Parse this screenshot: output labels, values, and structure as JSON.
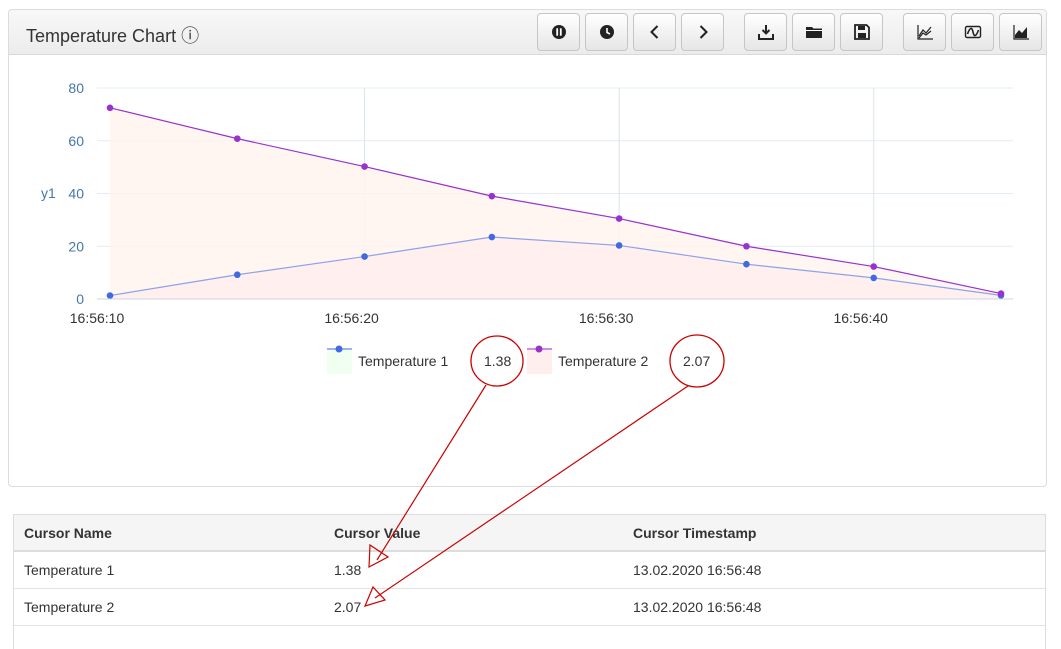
{
  "panel": {
    "title": "Temperature Chart ⓘ"
  },
  "toolbar": {
    "buttons": [
      {
        "name": "pause-button",
        "icon": "pause-icon"
      },
      {
        "name": "history-button",
        "icon": "clock-icon"
      },
      {
        "name": "previous-button",
        "icon": "chevron-left-icon"
      },
      {
        "name": "next-button",
        "icon": "chevron-right-icon"
      },
      {
        "name": "download-button",
        "icon": "download-icon"
      },
      {
        "name": "open-folder-button",
        "icon": "folder-icon"
      },
      {
        "name": "save-button",
        "icon": "floppy-disk-icon"
      },
      {
        "name": "line-chart-button",
        "icon": "line-chart-icon"
      },
      {
        "name": "wave-button",
        "icon": "sine-wave-icon"
      },
      {
        "name": "area-chart-button",
        "icon": "area-chart-icon"
      }
    ]
  },
  "chart_data": {
    "type": "line",
    "ylabel": "y1",
    "ylim": [
      0,
      80
    ],
    "yticks": [
      "0",
      "20",
      "40",
      "60",
      "80"
    ],
    "xticks": [
      "16:56:10",
      "16:56:20",
      "16:56:30",
      "16:56:40"
    ],
    "x": [
      "16:56:10",
      "16:56:15",
      "16:56:20",
      "16:56:25",
      "16:56:30",
      "16:56:35",
      "16:56:40",
      "16:56:45"
    ],
    "grid": true,
    "legend": "bottom",
    "series": [
      {
        "name": "Temperature 1",
        "color": "#4169e1",
        "values": [
          1.3,
          9.2,
          16.1,
          23.5,
          20.3,
          13.2,
          8.0,
          1.38
        ],
        "cursor_value": "1.38"
      },
      {
        "name": "Temperature 2",
        "color": "#9932cc",
        "values": [
          72.5,
          60.8,
          50.2,
          39.0,
          30.5,
          20.0,
          12.3,
          2.07
        ],
        "cursor_value": "2.07"
      }
    ]
  },
  "table": {
    "headers": [
      "Cursor Name",
      "Cursor Value",
      "Cursor Timestamp"
    ],
    "rows": [
      [
        "Temperature 1",
        "1.38",
        "13.02.2020 16:56:48"
      ],
      [
        "Temperature 2",
        "2.07",
        "13.02.2020 16:56:48"
      ]
    ]
  },
  "colors": {
    "annotation": "#cc0000",
    "axis_text": "#4477aa",
    "area_fill": "#ffeeee"
  }
}
